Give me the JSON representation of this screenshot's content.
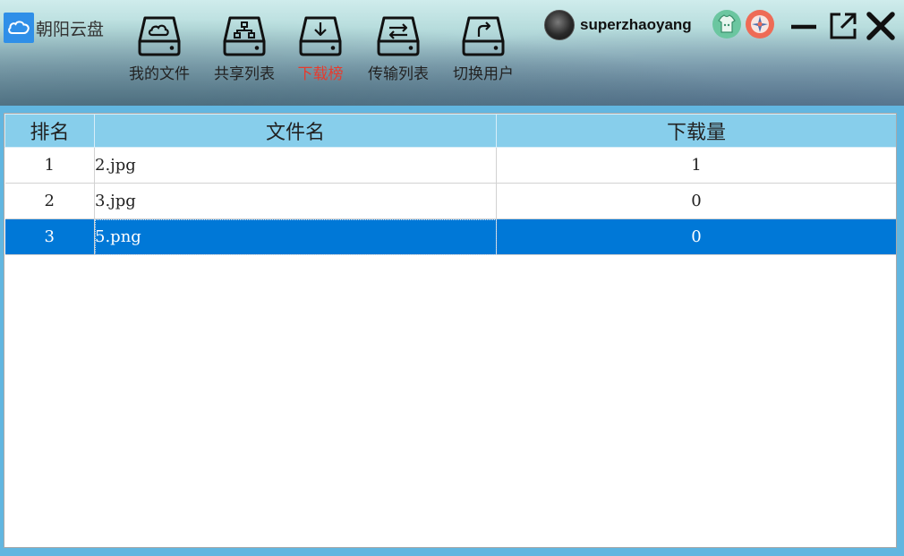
{
  "app": {
    "title": "朝阳云盘"
  },
  "nav": [
    {
      "label": "我的文件",
      "icon": "cloud-drive-icon"
    },
    {
      "label": "共享列表",
      "icon": "share-drive-icon"
    },
    {
      "label": "下载榜",
      "icon": "download-drive-icon",
      "active": true
    },
    {
      "label": "传输列表",
      "icon": "transfer-drive-icon"
    },
    {
      "label": "切换用户",
      "icon": "switch-user-drive-icon"
    }
  ],
  "user": {
    "name": "superzhaoyang"
  },
  "colors": {
    "active_nav": "#e83a2c",
    "table_header": "#87ceeb",
    "selection": "#0078d7"
  },
  "table": {
    "headers": {
      "rank": "排名",
      "name": "文件名",
      "count": "下载量"
    },
    "rows": [
      {
        "rank": "1",
        "name": "2.jpg",
        "count": "1"
      },
      {
        "rank": "2",
        "name": "3.jpg",
        "count": "0"
      },
      {
        "rank": "3",
        "name": "5.png",
        "count": "0",
        "selected": true
      }
    ]
  }
}
